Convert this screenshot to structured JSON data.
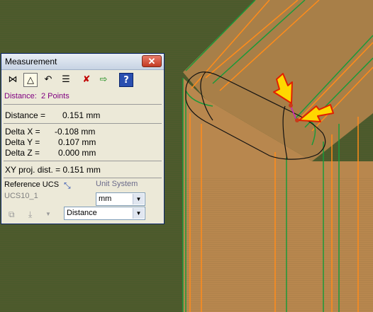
{
  "window": {
    "title": "Measurement",
    "close_glyph": "✕"
  },
  "toolbar": [
    {
      "name": "point-to-point-icon",
      "glyph": "⋈",
      "active": false
    },
    {
      "name": "triangle-measure-icon",
      "glyph": "△",
      "active": true
    },
    {
      "name": "arc-measure-icon",
      "glyph": "↶",
      "active": false
    },
    {
      "name": "list-view-icon",
      "glyph": "☰",
      "active": false
    },
    {
      "name": "clear-selection-icon",
      "glyph": "✘",
      "active": false
    },
    {
      "name": "export-icon",
      "glyph": "⇨",
      "active": false
    },
    {
      "name": "help-icon",
      "glyph": "?",
      "active": false
    }
  ],
  "mode_text": "Distance:  2 Points",
  "distance": {
    "label": "Distance =",
    "value": "0.151 mm"
  },
  "deltas": [
    {
      "label": "Delta X =",
      "value": "-0.108 mm"
    },
    {
      "label": "Delta Y =",
      "value": "0.107 mm"
    },
    {
      "label": "Delta Z =",
      "value": "0.000 mm"
    }
  ],
  "xy_proj": "XY proj. dist. = 0.151 mm",
  "reference": {
    "label": "Reference UCS",
    "value": "UCS10_1"
  },
  "unit_system": {
    "label": "Unit System",
    "selected": "mm"
  },
  "measure_type": {
    "selected": "Distance"
  },
  "colors": {
    "background": "#4b5a2c",
    "part_fill": "#b07d45",
    "orange_edge": "#ff8c1a",
    "green_edge": "#1a9a3a",
    "arrow_fill": "#ffd700",
    "arrow_outline": "#e02000"
  }
}
